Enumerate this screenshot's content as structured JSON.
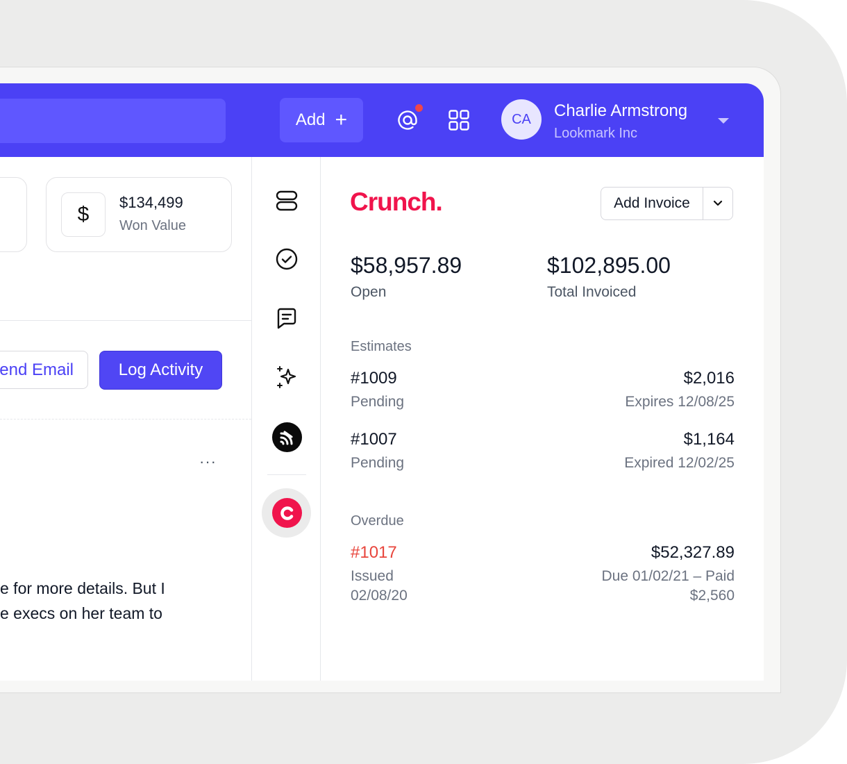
{
  "header": {
    "add_label": "Add",
    "user_initials": "CA",
    "user_name": "Charlie Armstrong",
    "user_company": "Lookmark Inc",
    "icons": [
      "mention-icon",
      "apps-grid-icon",
      "chevron-down-icon"
    ],
    "accent_color": "#4b41f5"
  },
  "stats": {
    "won_value": "$134,499",
    "won_label": "Won Value",
    "won_icon": "$"
  },
  "actions": {
    "send_email": "end Email",
    "log_activity": "Log Activity",
    "more": "···"
  },
  "note": {
    "line1": "e for more details. But I",
    "line2": "е execs on her team to"
  },
  "rail": {
    "icons": [
      "stack-icon",
      "check-circle-icon",
      "message-icon",
      "sparkles-icon",
      "integration-icon",
      "crunch-icon"
    ]
  },
  "panel": {
    "logo": "Crunch.",
    "add_invoice": "Add Invoice",
    "open_value": "$58,957.89",
    "open_label": "Open",
    "total_value": "$102,895.00",
    "total_label": "Total Invoiced",
    "estimates_label": "Estimates",
    "estimates": [
      {
        "number": "#1009",
        "status": "Pending",
        "amount": "$2,016",
        "sub": "Expires 12/08/25"
      },
      {
        "number": "#1007",
        "status": "Pending",
        "amount": "$1,164",
        "sub": "Expired 12/02/25"
      }
    ],
    "overdue_label": "Overdue",
    "overdue": [
      {
        "number": "#1017",
        "status_line1": "Issued",
        "status_line2": "02/08/20",
        "amount": "$52,327.89",
        "sub_line1": "Due 01/02/21 – Paid",
        "sub_line2": "$2,560"
      }
    ],
    "brand_color": "#f0144c",
    "overdue_color": "#e8453c"
  }
}
